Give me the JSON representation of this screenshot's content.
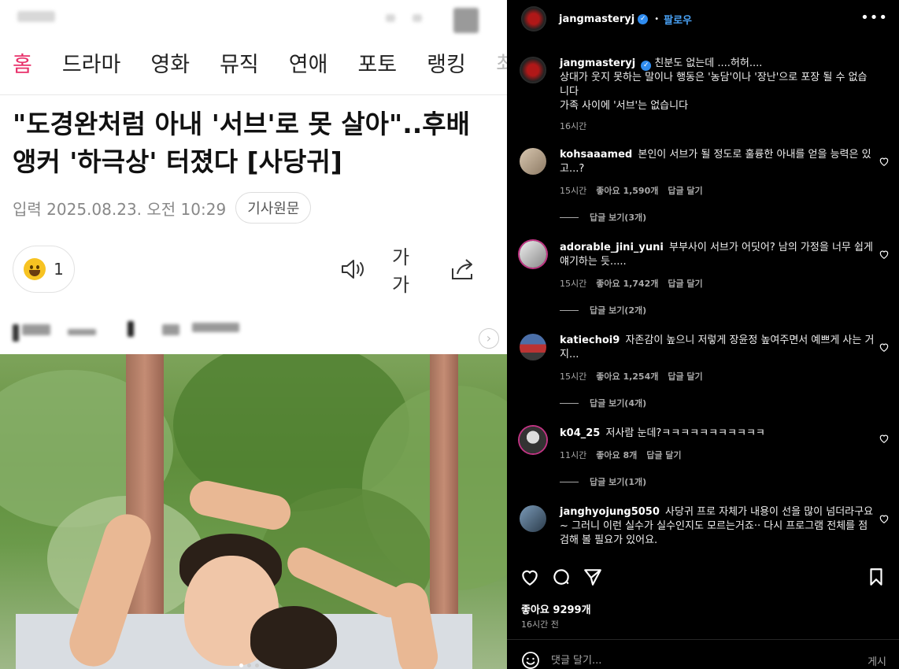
{
  "news": {
    "tabs": [
      "홈",
      "드라마",
      "영화",
      "뮤직",
      "연애",
      "포토",
      "랭킹",
      "최"
    ],
    "headline": "\"도경완처럼 아내 '서브'로 못 살아\"..후배 앵커 '하극상' 터졌다 [사당귀]",
    "date": "입력 2025.08.23. 오전 10:29",
    "original_button": "기사원문",
    "reaction_count": "1",
    "font_size_label": "가가",
    "icons": [
      "speaker-icon",
      "share-icon",
      "chevron-right-icon"
    ]
  },
  "instagram": {
    "author": "jangmasteryj",
    "follow_label": "팔로우",
    "caption": {
      "user": "jangmasteryj",
      "text": "친분도 없는데 ....허허....\n상대가 웃지 못하는 말이나 행동은 '농담'이나 '장난'으로 포장 될 수 없습니다\n가족 사이에 '서브'는 없습니다",
      "time": "16시간"
    },
    "comments": [
      {
        "user": "kohsaaamed",
        "text": "본인이 서브가 될 정도로 훌륭한 아내를 얻을 능력은 있고...?",
        "time": "15시간",
        "likes": "좋아요 1,590개",
        "reply": "답글 달기",
        "view_replies": "답글 보기(3개)"
      },
      {
        "user": "adorable_jini_yuni",
        "text": "부부사이 서브가 어딧어? 남의 가정을 너무 쉽게 얘기하는 듯.....",
        "time": "15시간",
        "likes": "좋아요 1,742개",
        "reply": "답글 달기",
        "view_replies": "답글 보기(2개)"
      },
      {
        "user": "katiechoi9",
        "text": "자존감이 높으니 저렇게 장윤정 높여주면서 예쁘게 사는 거지...",
        "time": "15시간",
        "likes": "좋아요 1,254개",
        "reply": "답글 달기",
        "view_replies": "답글 보기(4개)"
      },
      {
        "user": "k04_25",
        "text": "저사람 눈데?ㅋㅋㅋㅋㅋㅋㅋㅋㅋㅋㅋ",
        "time": "11시간",
        "likes": "좋아요 8개",
        "reply": "답글 달기",
        "view_replies": "답글 보기(1개)"
      },
      {
        "user": "janghyojung5050",
        "text": "사당귀 프로 자체가 내용이 선을 많이 넘더라구요~ 그러니 이런 실수가 실수인지도 모르는거죠·· 다시 프로그램 전체를 점검해 볼 필요가 있어요.",
        "time": "",
        "likes": "",
        "reply": "",
        "view_replies": ""
      }
    ],
    "likes_total": "좋아요 9299개",
    "posted": "16시간 전",
    "comment_placeholder": "댓글 달기...",
    "post_label": "게시",
    "colors": {
      "accent": "#4aa3f7",
      "verified": "#2f8cf0",
      "tab_active": "#e8306a"
    }
  }
}
